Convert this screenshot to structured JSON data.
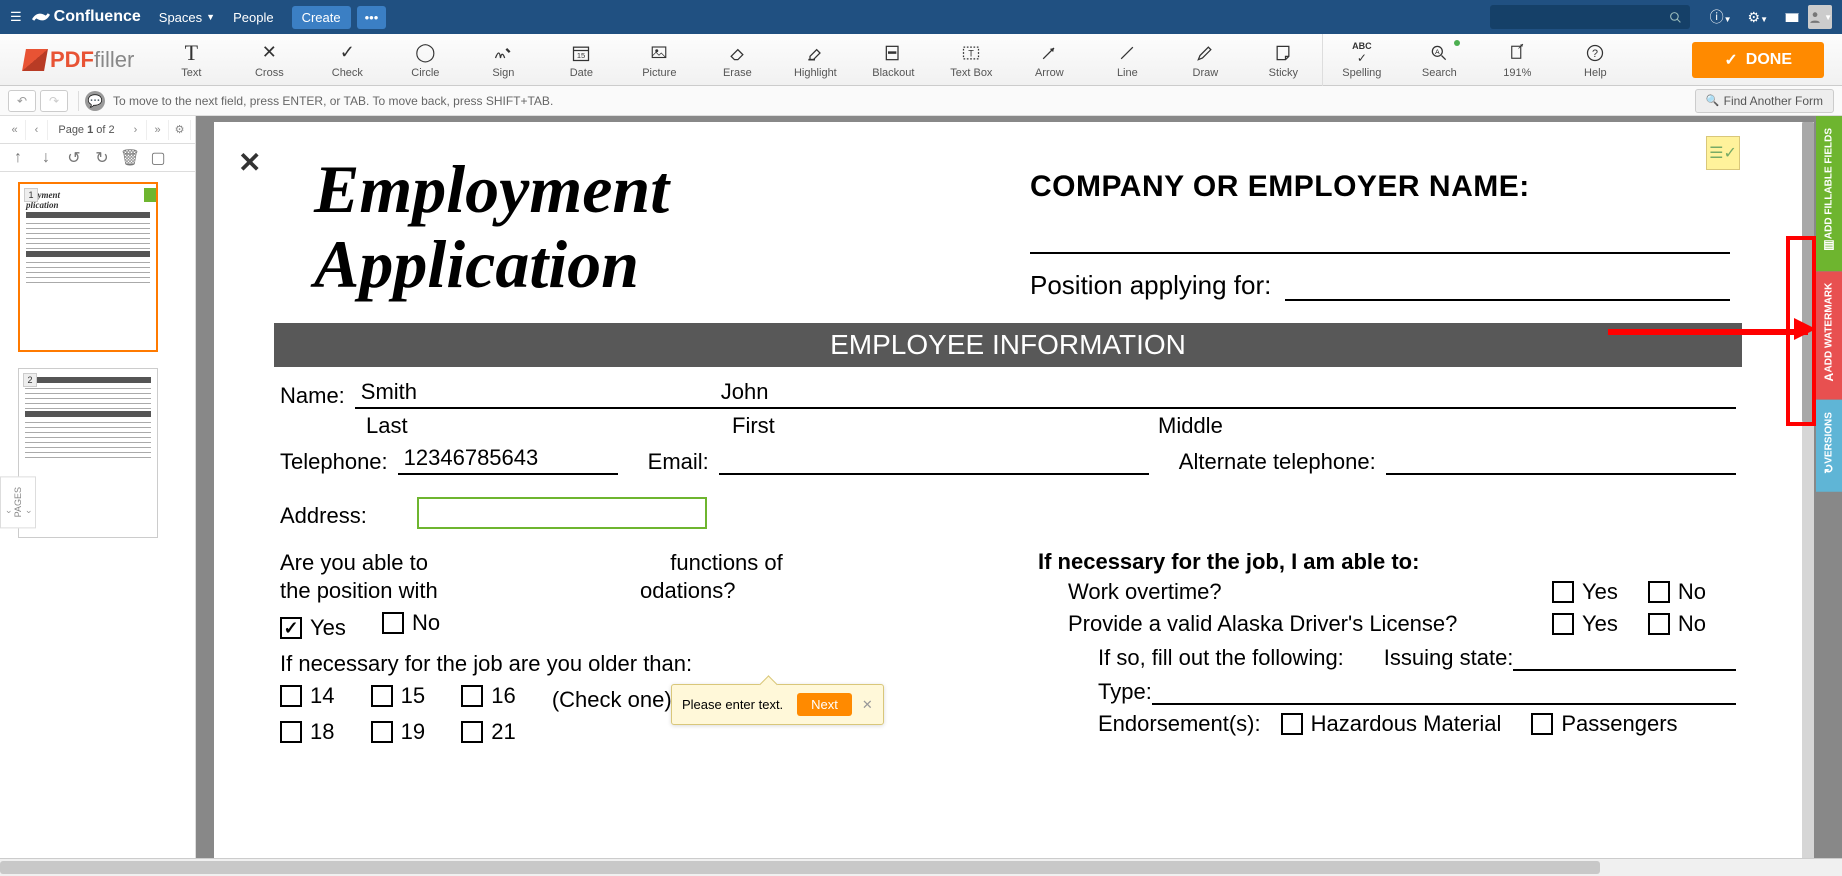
{
  "confluence": {
    "logo": "Confluence",
    "nav": {
      "spaces": "Spaces",
      "people": "People",
      "create": "Create"
    }
  },
  "pdffiller": {
    "logo1": "PDF",
    "logo2": "filler",
    "tools": {
      "text": "Text",
      "cross": "Cross",
      "check": "Check",
      "circle": "Circle",
      "sign": "Sign",
      "date": "Date",
      "picture": "Picture",
      "erase": "Erase",
      "highlight": "Highlight",
      "blackout": "Blackout",
      "textbox": "Text Box",
      "arrow": "Arrow",
      "line": "Line",
      "draw": "Draw",
      "sticky": "Sticky",
      "spelling": "Spelling",
      "search": "Search",
      "zoom": "191%",
      "help": "Help"
    },
    "done": "DONE"
  },
  "hintbar": {
    "text": "To move to the next field, press ENTER, or TAB. To move back, press SHIFT+TAB.",
    "find": "Find Another Form"
  },
  "pages": {
    "indicator_pre": "Page ",
    "indicator_cur": "1",
    "indicator_post": " of 2",
    "label": "PAGES"
  },
  "doc": {
    "title1": "Employment",
    "title2": "Application",
    "company_label": "COMPANY OR EMPLOYER NAME:",
    "position_label": "Position applying for:",
    "section1": "EMPLOYEE INFORMATION",
    "name_label": "Name:",
    "last_name": "Smith",
    "last_sub": "Last",
    "first_name": "John",
    "first_sub": "First",
    "middle_sub": "Middle",
    "tel_label": "Telephone:",
    "tel_value": "12346785643",
    "email_label": "Email:",
    "alt_tel_label": "Alternate telephone:",
    "address_label": "Address:",
    "q1a": "Are you able to",
    "q1b": "functions of",
    "q1c": "the position with",
    "q1d": "odations?",
    "yes": "Yes",
    "no": "No",
    "q2": "If necessary for the job are you older than:",
    "ages": [
      "14",
      "15",
      "16",
      "18",
      "19",
      "21"
    ],
    "check_one": "(Check one)",
    "r_head": "If necessary for the job, I am able to:",
    "r_work_ot": "Work overtime?",
    "r_license": "Provide a valid Alaska Driver's License?",
    "r_ifso": "If so, fill out the following:",
    "r_issuing": "Issuing state:",
    "r_type": "Type:",
    "r_endorse": "Endorsement(s):",
    "r_haz": "Hazardous Material",
    "r_pass": "Passengers"
  },
  "tooltip": {
    "text": "Please enter text.",
    "next": "Next"
  },
  "sidetabs": {
    "fillable": "ADD FILLABLE FIELDS",
    "watermark": "ADD WATERMARK",
    "versions": "VERSIONS"
  }
}
